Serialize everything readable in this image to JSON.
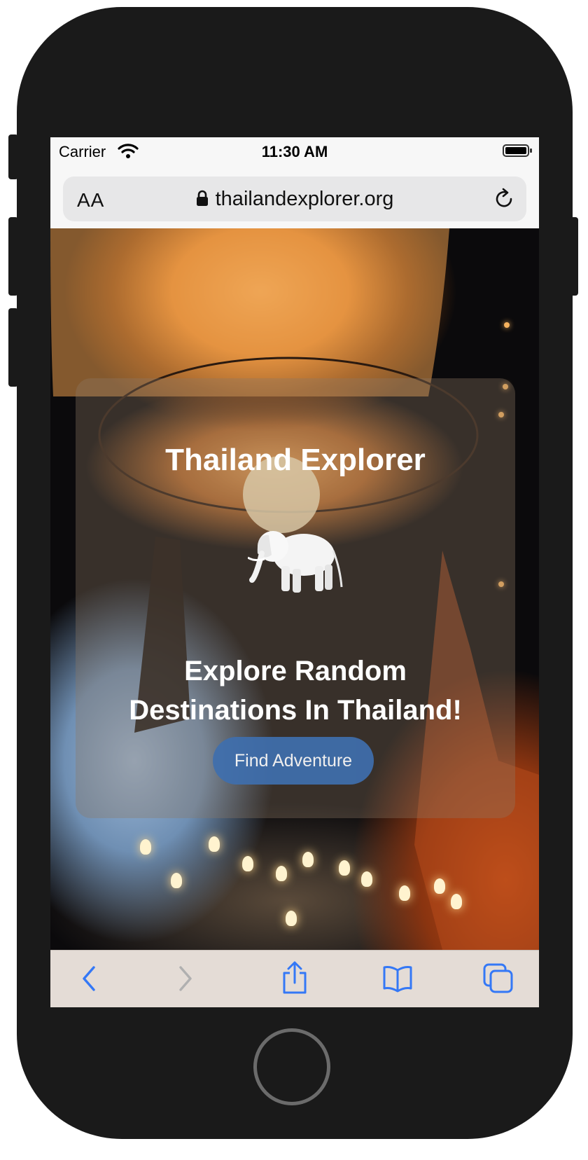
{
  "status_bar": {
    "carrier": "Carrier",
    "time": "11:30 AM"
  },
  "browser": {
    "text_size_label": "AA",
    "url": "thailandexplorer.org"
  },
  "page": {
    "title": "Thailand Explorer",
    "tagline_line1": "Explore Random",
    "tagline_line2": "Destinations In Thailand!",
    "cta_label": "Find Adventure"
  },
  "toolbar": {
    "back_icon": "chevron-left-icon",
    "forward_icon": "chevron-right-icon",
    "share_icon": "share-icon",
    "bookmarks_icon": "book-icon",
    "tabs_icon": "tabs-icon",
    "accent_color": "#3478f6",
    "disabled_color": "#b0b0b0"
  },
  "colors": {
    "cta_background": "#3f6fae",
    "device_frame": "#1a1a1a"
  }
}
